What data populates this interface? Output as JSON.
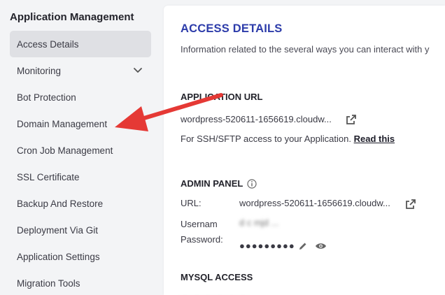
{
  "sidebar": {
    "heading": "Application Management",
    "items": [
      {
        "label": "Access Details"
      },
      {
        "label": "Monitoring"
      },
      {
        "label": "Bot Protection"
      },
      {
        "label": "Domain Management"
      },
      {
        "label": "Cron Job Management"
      },
      {
        "label": "SSL Certificate"
      },
      {
        "label": "Backup And Restore"
      },
      {
        "label": "Deployment Via Git"
      },
      {
        "label": "Application Settings"
      },
      {
        "label": "Migration Tools"
      }
    ]
  },
  "main": {
    "title": "ACCESS DETAILS",
    "subtitle": "Information related to the several ways you can interact with y",
    "application_url": {
      "heading": "APPLICATION URL",
      "url": "wordpress-520611-1656619.cloudw...",
      "ssh_text": "For SSH/SFTP access to your Application.",
      "ssh_link": "Read this"
    },
    "admin_panel": {
      "heading": "ADMIN PANEL",
      "url_label": "URL:",
      "url_value": "wordpress-520611-1656619.cloudw...",
      "username_label": "Usernam",
      "username_value": "d c mjd ...",
      "password_label": "Password:",
      "password_value": "●●●●●●●●●"
    },
    "mysql": {
      "heading": "MYSQL ACCESS"
    }
  },
  "colors": {
    "accent": "#2d3caa",
    "arrow": "#e53935",
    "active_bg": "#dfe0e4"
  }
}
